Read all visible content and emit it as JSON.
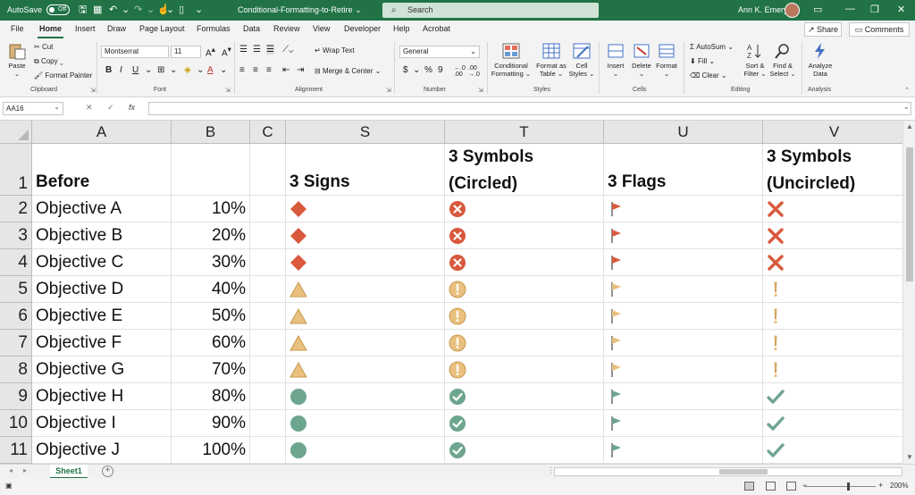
{
  "titlebar": {
    "autosave_label": "AutoSave",
    "autosave_state": "Off",
    "filename": "Conditional-Formatting-to-Retire",
    "filename_chevron": "⌄",
    "search_placeholder": "Search",
    "user_name": "Ann K. Emery"
  },
  "tabs": [
    "File",
    "Home",
    "Insert",
    "Draw",
    "Page Layout",
    "Formulas",
    "Data",
    "Review",
    "View",
    "Developer",
    "Help",
    "Acrobat"
  ],
  "active_tab": "Home",
  "share_label": "Share",
  "comments_label": "Comments",
  "ribbon": {
    "clipboard": {
      "paste": "Paste",
      "cut": "Cut",
      "copy": "Copy",
      "format_painter": "Format Painter",
      "label": "Clipboard"
    },
    "font": {
      "name": "Montserrat",
      "size": "11",
      "bold": "B",
      "italic": "I",
      "underline": "U",
      "label": "Font"
    },
    "alignment": {
      "wrap_text": "Wrap Text",
      "merge_center": "Merge & Center",
      "label": "Alignment"
    },
    "number": {
      "format": "General",
      "currency": "$",
      "percent": "%",
      "comma": "9",
      "label": "Number"
    },
    "styles": {
      "conditional": "Conditional\nFormatting",
      "format_table": "Format as\nTable",
      "cell_styles": "Cell\nStyles",
      "label": "Styles"
    },
    "cells": {
      "insert": "Insert",
      "delete": "Delete",
      "format": "Format",
      "label": "Cells"
    },
    "editing": {
      "autosum": "AutoSum",
      "fill": "Fill",
      "clear": "Clear",
      "sort_filter": "Sort &\nFilter",
      "find_select": "Find &\nSelect",
      "label": "Editing"
    },
    "analysis": {
      "analyze": "Analyze\nData",
      "label": "Analysis"
    }
  },
  "formula_bar": {
    "name_box": "AA16",
    "fx": "fx",
    "value": ""
  },
  "columns": [
    "A",
    "B",
    "C",
    "S",
    "T",
    "U",
    "V"
  ],
  "rows": [
    "1",
    "2",
    "3",
    "4",
    "5",
    "6",
    "7",
    "8",
    "9",
    "10",
    "11"
  ],
  "headers": {
    "a1": "Before",
    "s1": "3 Signs",
    "t1_line1": "3 Symbols",
    "t1_line2": "(Circled)",
    "u1": "3 Flags",
    "v1_line1": "3 Symbols",
    "v1_line2": "(Uncircled)"
  },
  "data_rows": [
    {
      "objective": "Objective A",
      "percent": "10%",
      "level": "red"
    },
    {
      "objective": "Objective B",
      "percent": "20%",
      "level": "red"
    },
    {
      "objective": "Objective C",
      "percent": "30%",
      "level": "red"
    },
    {
      "objective": "Objective D",
      "percent": "40%",
      "level": "yellow"
    },
    {
      "objective": "Objective E",
      "percent": "50%",
      "level": "yellow"
    },
    {
      "objective": "Objective F",
      "percent": "60%",
      "level": "yellow"
    },
    {
      "objective": "Objective G",
      "percent": "70%",
      "level": "yellow"
    },
    {
      "objective": "Objective H",
      "percent": "80%",
      "level": "green"
    },
    {
      "objective": "Objective I",
      "percent": "90%",
      "level": "green"
    },
    {
      "objective": "Objective J",
      "percent": "100%",
      "level": "green"
    }
  ],
  "colors": {
    "red": "#d9593d",
    "yellow": "#e9c07f",
    "green": "#6ea58f",
    "excel_green": "#217346"
  },
  "sheet_tab": "Sheet1",
  "zoom": "200%"
}
